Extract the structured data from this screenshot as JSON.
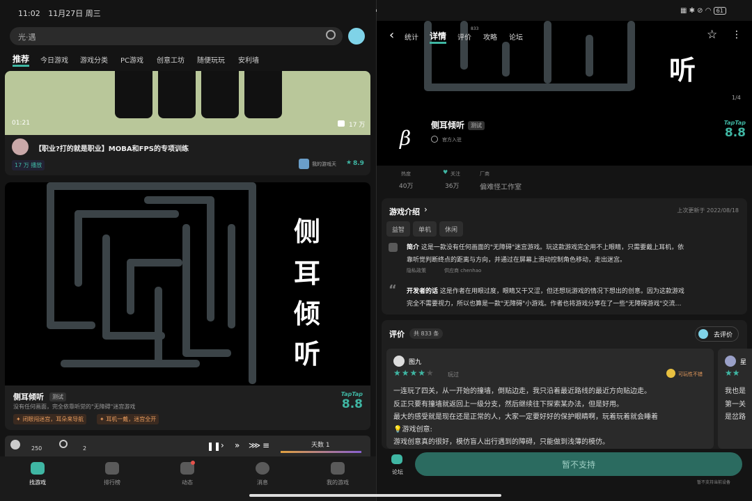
{
  "status_left": {
    "time": "11:02",
    "date": "11月27日 周三"
  },
  "status_right": {
    "battery": "61"
  },
  "left": {
    "search": {
      "placeholder": "光·遇"
    },
    "tabs": [
      "推荐",
      "今日游戏",
      "游戏分类",
      "PC游戏",
      "创意工坊",
      "随便玩玩",
      "安利墙"
    ],
    "video_card": {
      "duration": "01:21",
      "views_icon": "17 万",
      "title": "【职业?打的就是职业】MOBA和FPS的专项训练",
      "plays": "17 万 播放",
      "source": "我的游戏天",
      "rating": "8.9"
    },
    "game_card": {
      "chars": [
        "侧",
        "耳",
        "倾",
        "听"
      ],
      "name": "侧耳倾听",
      "tag": "测试",
      "desc": "没有任何画面，完全依靠听觉的\"无障碍\"迷宫游戏",
      "tags": [
        "闭眼闯迷宫，耳朵来导航",
        "耳机一戴，迷宫全开"
      ],
      "taptap": "TapTap",
      "score": "8.8"
    },
    "game_hud": {
      "coins": "250",
      "gears": "2",
      "day": "天数 1"
    },
    "bottom_nav": [
      "找游戏",
      "排行榜",
      "动态",
      "消息",
      "我的游戏"
    ]
  },
  "right": {
    "topnav": {
      "tabs": [
        "统计",
        "详情",
        "评价",
        "攻略",
        "论坛"
      ],
      "review_count": "833"
    },
    "header": {
      "hero_char": "听",
      "page_indicator": "1/4",
      "logo_char": "β",
      "name": "侧耳倾听",
      "tag": "测试",
      "official": "官方入驻",
      "taptap": "TapTap",
      "score": "8.8"
    },
    "stats": [
      {
        "label": "热度",
        "value": "40万"
      },
      {
        "label": "关注",
        "value": "36万"
      },
      {
        "label": "厂商",
        "value": "偏难怪工作室"
      }
    ],
    "intro": {
      "title": "游戏介绍",
      "updated": "上次更新于 2022/08/18",
      "chips": [
        "益智",
        "单机",
        "休闲"
      ],
      "brief_label": "简介",
      "brief": "这是一款没有任何画面的\"无障碍\"迷宫游戏。玩这款游戏完全用不上眼睛，只需要戴上耳机，依",
      "brief2": "靠听觉判断终点的距离与方向，并通过在屏幕上滑动控制角色移动，走出迷宫。",
      "privacy": "隐私政策",
      "supplier": "供应商 chenhao",
      "dev_label": "开发者的话",
      "dev": "这是作者在用眼过度，眼睛又干又涩，但还想玩游戏的情况下想出的创意。因为这款游戏",
      "dev2": "完全不需要视力，所以也算是一款\"无障碍\"小游戏。作者也将游戏分享在了一些\"无障碍游戏\"交流…"
    },
    "reviews": {
      "title": "评价",
      "count": "共 833 条",
      "go_review": "去评价",
      "main": {
        "user": "图九",
        "played": "玩过",
        "mood": "可玩性不错",
        "lines": [
          "一连玩了四关，从一开始的撞墙，倒贴边走，我只沿着最近路线的最近方向贴边走。",
          "反正只要有撞墙就返回上一级分支，然后继续往下探索某办法，但是好用。",
          "最大的感受就是现在还是正常的人，大家一定要好好的保护眼睛啊，玩着玩着就会睡着",
          "💡游戏创意:",
          "游戏创意真的很好，模仿盲人出行遇到的障碍，只能做到浅薄的模仿。"
        ]
      },
      "side": {
        "user": "星",
        "lines": [
          "我也是",
          "第一关",
          "是岔路"
        ]
      }
    },
    "bottom": {
      "forum": "论坛",
      "button": "暂不支持",
      "note": "暂不支持当前设备"
    }
  }
}
